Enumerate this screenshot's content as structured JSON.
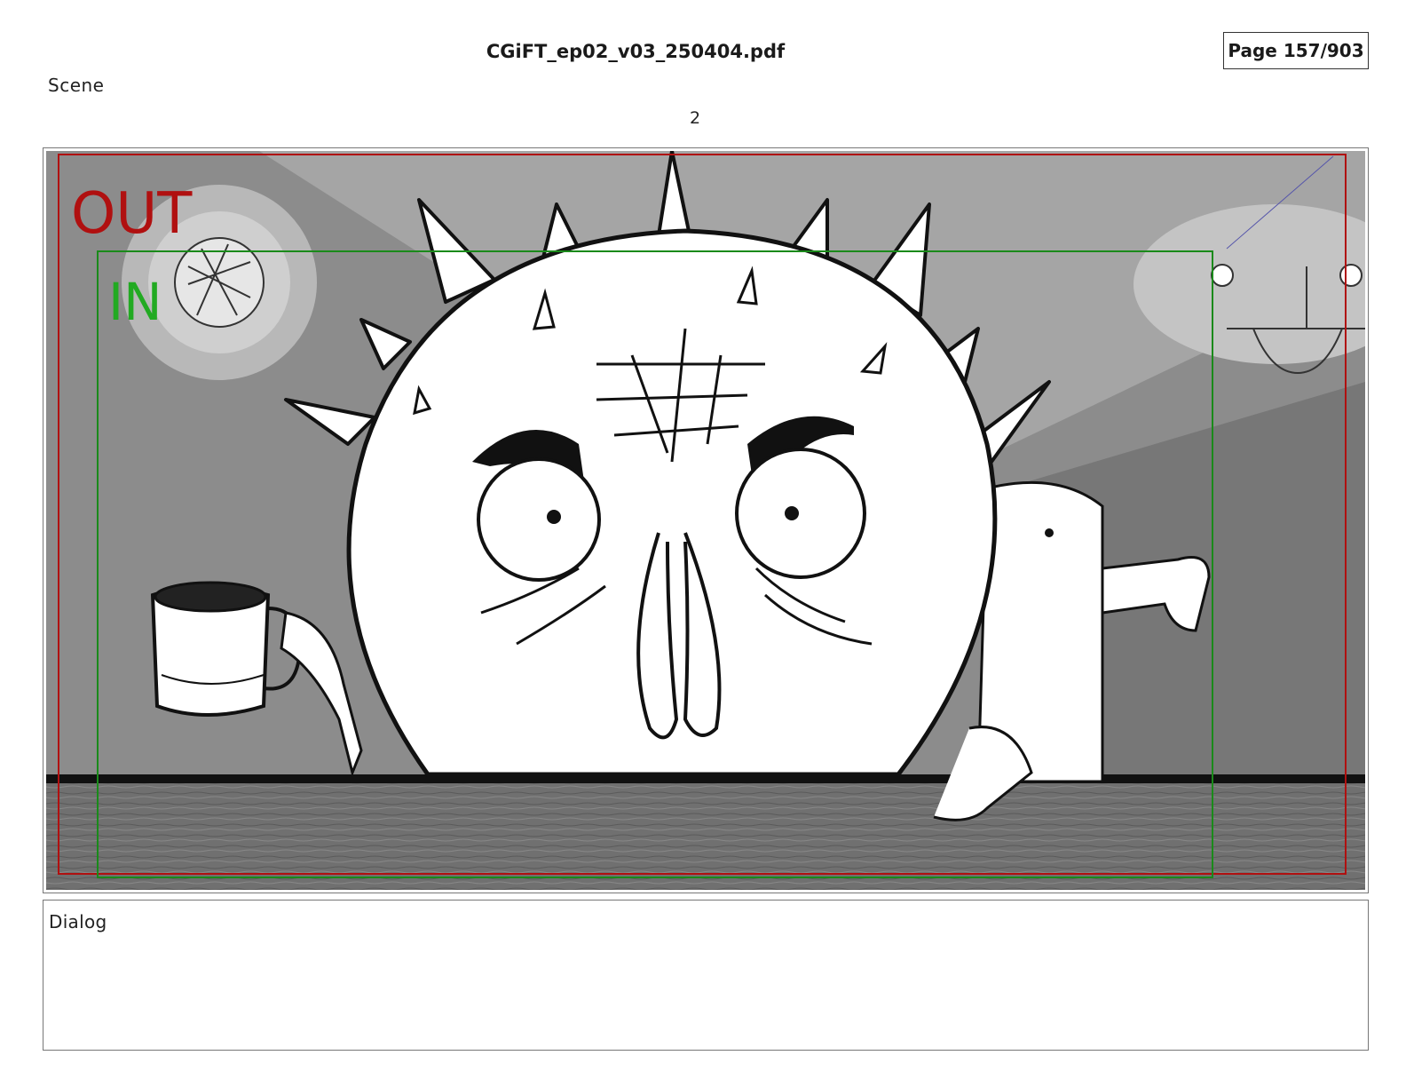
{
  "header": {
    "file_name": "CGiFT_ep02_v03_250404.pdf",
    "page_indicator": "Page 157/903"
  },
  "scene": {
    "label": "Scene",
    "number": "2"
  },
  "panel": {
    "safe_frame_out_label": "OUT",
    "safe_frame_in_label": "IN",
    "colors": {
      "out_frame": "#b01010",
      "in_frame": "#1a8a1a",
      "background_gray": "#8a8a8a",
      "table_wood": "#6e6e6e"
    }
  },
  "dialog": {
    "label": "Dialog",
    "text": ""
  }
}
